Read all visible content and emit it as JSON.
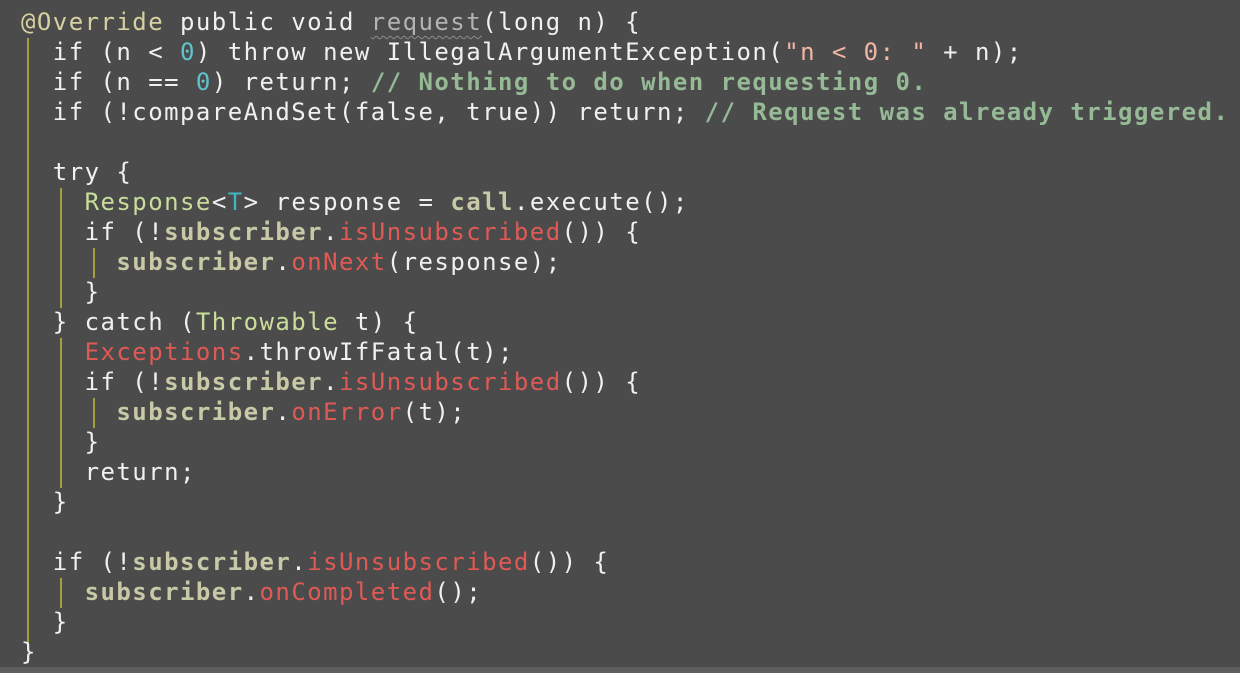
{
  "editor": {
    "colors": {
      "background": "#4b4b4b",
      "text": "#f0f0f0",
      "comment": "#96b996",
      "number": "#5fc2cc",
      "string": "#f4b6a4",
      "type": "#c9de9a",
      "field": "#c8c9a6",
      "static_method": "#e05a55",
      "indent_guide": "#a6a03c"
    },
    "lines": [
      [
        {
          "t": "@Override",
          "c": "ann"
        },
        {
          "t": " public void ",
          "c": "kw"
        },
        {
          "t": "request",
          "c": "unused"
        },
        {
          "t": "(long n) {",
          "c": "plain"
        }
      ],
      [
        {
          "t": "  if (n < ",
          "c": "plain"
        },
        {
          "t": "0",
          "c": "num"
        },
        {
          "t": ") throw new IllegalArgumentException(",
          "c": "plain"
        },
        {
          "t": "\"n < 0: \"",
          "c": "str"
        },
        {
          "t": " + n);",
          "c": "plain"
        }
      ],
      [
        {
          "t": "  if (n == ",
          "c": "plain"
        },
        {
          "t": "0",
          "c": "num"
        },
        {
          "t": ") return; ",
          "c": "plain"
        },
        {
          "t": "// Nothing to do when requesting 0.",
          "c": "cmt"
        }
      ],
      [
        {
          "t": "  if (!compareAndSet(false, true)) return; ",
          "c": "plain"
        },
        {
          "t": "// Request was already triggered.",
          "c": "cmt"
        }
      ],
      [
        {
          "t": "",
          "c": "plain"
        }
      ],
      [
        {
          "t": "  try {",
          "c": "plain"
        }
      ],
      [
        {
          "t": "    ",
          "c": "plain"
        },
        {
          "t": "Response",
          "c": "type"
        },
        {
          "t": "<",
          "c": "plain"
        },
        {
          "t": "T",
          "c": "tparam"
        },
        {
          "t": "> response = ",
          "c": "plain"
        },
        {
          "t": "call",
          "c": "field"
        },
        {
          "t": ".execute();",
          "c": "plain"
        }
      ],
      [
        {
          "t": "    if (!",
          "c": "plain"
        },
        {
          "t": "subscriber",
          "c": "field"
        },
        {
          "t": ".",
          "c": "plain"
        },
        {
          "t": "isUnsubscribed",
          "c": "meth"
        },
        {
          "t": "()) {",
          "c": "plain"
        }
      ],
      [
        {
          "t": "      ",
          "c": "plain"
        },
        {
          "t": "subscriber",
          "c": "field"
        },
        {
          "t": ".",
          "c": "plain"
        },
        {
          "t": "onNext",
          "c": "meth"
        },
        {
          "t": "(response);",
          "c": "plain"
        }
      ],
      [
        {
          "t": "    }",
          "c": "plain"
        }
      ],
      [
        {
          "t": "  } catch (",
          "c": "plain"
        },
        {
          "t": "Throwable",
          "c": "type"
        },
        {
          "t": " t) {",
          "c": "plain"
        }
      ],
      [
        {
          "t": "    ",
          "c": "plain"
        },
        {
          "t": "Exceptions",
          "c": "meth"
        },
        {
          "t": ".throwIfFatal(t);",
          "c": "plain"
        }
      ],
      [
        {
          "t": "    if (!",
          "c": "plain"
        },
        {
          "t": "subscriber",
          "c": "field"
        },
        {
          "t": ".",
          "c": "plain"
        },
        {
          "t": "isUnsubscribed",
          "c": "meth"
        },
        {
          "t": "()) {",
          "c": "plain"
        }
      ],
      [
        {
          "t": "      ",
          "c": "plain"
        },
        {
          "t": "subscriber",
          "c": "field"
        },
        {
          "t": ".",
          "c": "plain"
        },
        {
          "t": "onError",
          "c": "meth"
        },
        {
          "t": "(t);",
          "c": "plain"
        }
      ],
      [
        {
          "t": "    }",
          "c": "plain"
        }
      ],
      [
        {
          "t": "    return;",
          "c": "plain"
        }
      ],
      [
        {
          "t": "  }",
          "c": "plain"
        }
      ],
      [
        {
          "t": "",
          "c": "plain"
        }
      ],
      [
        {
          "t": "  if (!",
          "c": "plain"
        },
        {
          "t": "subscriber",
          "c": "field"
        },
        {
          "t": ".",
          "c": "plain"
        },
        {
          "t": "isUnsubscribed",
          "c": "meth"
        },
        {
          "t": "()) {",
          "c": "plain"
        }
      ],
      [
        {
          "t": "    ",
          "c": "plain"
        },
        {
          "t": "subscriber",
          "c": "field"
        },
        {
          "t": ".",
          "c": "plain"
        },
        {
          "t": "onCompleted",
          "c": "meth"
        },
        {
          "t": "();",
          "c": "plain"
        }
      ],
      [
        {
          "t": "  }",
          "c": "plain"
        }
      ],
      [
        {
          "t": "}",
          "c": "plain"
        }
      ]
    ]
  }
}
